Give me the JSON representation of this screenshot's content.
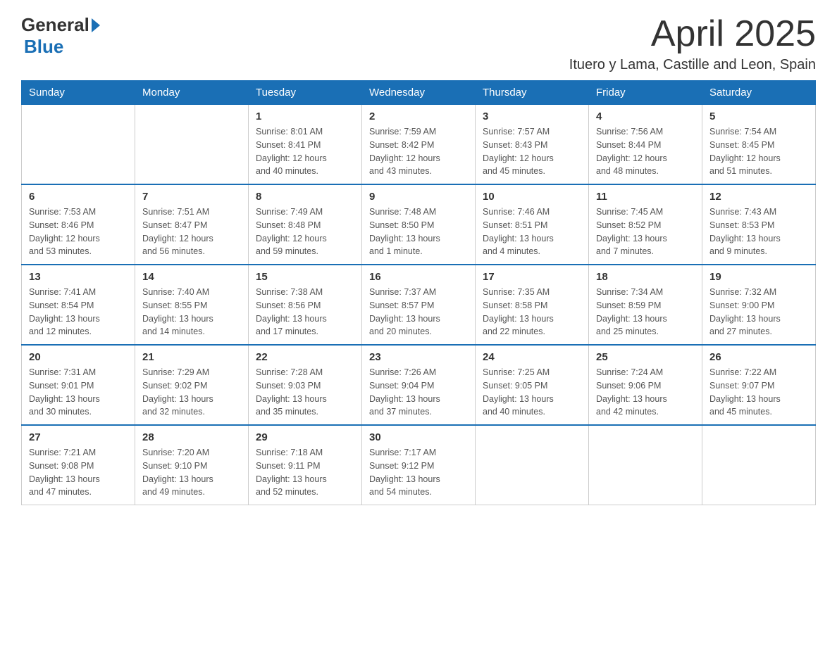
{
  "logo": {
    "general": "General",
    "blue": "Blue"
  },
  "title": "April 2025",
  "location": "Ituero y Lama, Castille and Leon, Spain",
  "days_of_week": [
    "Sunday",
    "Monday",
    "Tuesday",
    "Wednesday",
    "Thursday",
    "Friday",
    "Saturday"
  ],
  "weeks": [
    [
      {
        "day": "",
        "info": ""
      },
      {
        "day": "",
        "info": ""
      },
      {
        "day": "1",
        "info": "Sunrise: 8:01 AM\nSunset: 8:41 PM\nDaylight: 12 hours\nand 40 minutes."
      },
      {
        "day": "2",
        "info": "Sunrise: 7:59 AM\nSunset: 8:42 PM\nDaylight: 12 hours\nand 43 minutes."
      },
      {
        "day": "3",
        "info": "Sunrise: 7:57 AM\nSunset: 8:43 PM\nDaylight: 12 hours\nand 45 minutes."
      },
      {
        "day": "4",
        "info": "Sunrise: 7:56 AM\nSunset: 8:44 PM\nDaylight: 12 hours\nand 48 minutes."
      },
      {
        "day": "5",
        "info": "Sunrise: 7:54 AM\nSunset: 8:45 PM\nDaylight: 12 hours\nand 51 minutes."
      }
    ],
    [
      {
        "day": "6",
        "info": "Sunrise: 7:53 AM\nSunset: 8:46 PM\nDaylight: 12 hours\nand 53 minutes."
      },
      {
        "day": "7",
        "info": "Sunrise: 7:51 AM\nSunset: 8:47 PM\nDaylight: 12 hours\nand 56 minutes."
      },
      {
        "day": "8",
        "info": "Sunrise: 7:49 AM\nSunset: 8:48 PM\nDaylight: 12 hours\nand 59 minutes."
      },
      {
        "day": "9",
        "info": "Sunrise: 7:48 AM\nSunset: 8:50 PM\nDaylight: 13 hours\nand 1 minute."
      },
      {
        "day": "10",
        "info": "Sunrise: 7:46 AM\nSunset: 8:51 PM\nDaylight: 13 hours\nand 4 minutes."
      },
      {
        "day": "11",
        "info": "Sunrise: 7:45 AM\nSunset: 8:52 PM\nDaylight: 13 hours\nand 7 minutes."
      },
      {
        "day": "12",
        "info": "Sunrise: 7:43 AM\nSunset: 8:53 PM\nDaylight: 13 hours\nand 9 minutes."
      }
    ],
    [
      {
        "day": "13",
        "info": "Sunrise: 7:41 AM\nSunset: 8:54 PM\nDaylight: 13 hours\nand 12 minutes."
      },
      {
        "day": "14",
        "info": "Sunrise: 7:40 AM\nSunset: 8:55 PM\nDaylight: 13 hours\nand 14 minutes."
      },
      {
        "day": "15",
        "info": "Sunrise: 7:38 AM\nSunset: 8:56 PM\nDaylight: 13 hours\nand 17 minutes."
      },
      {
        "day": "16",
        "info": "Sunrise: 7:37 AM\nSunset: 8:57 PM\nDaylight: 13 hours\nand 20 minutes."
      },
      {
        "day": "17",
        "info": "Sunrise: 7:35 AM\nSunset: 8:58 PM\nDaylight: 13 hours\nand 22 minutes."
      },
      {
        "day": "18",
        "info": "Sunrise: 7:34 AM\nSunset: 8:59 PM\nDaylight: 13 hours\nand 25 minutes."
      },
      {
        "day": "19",
        "info": "Sunrise: 7:32 AM\nSunset: 9:00 PM\nDaylight: 13 hours\nand 27 minutes."
      }
    ],
    [
      {
        "day": "20",
        "info": "Sunrise: 7:31 AM\nSunset: 9:01 PM\nDaylight: 13 hours\nand 30 minutes."
      },
      {
        "day": "21",
        "info": "Sunrise: 7:29 AM\nSunset: 9:02 PM\nDaylight: 13 hours\nand 32 minutes."
      },
      {
        "day": "22",
        "info": "Sunrise: 7:28 AM\nSunset: 9:03 PM\nDaylight: 13 hours\nand 35 minutes."
      },
      {
        "day": "23",
        "info": "Sunrise: 7:26 AM\nSunset: 9:04 PM\nDaylight: 13 hours\nand 37 minutes."
      },
      {
        "day": "24",
        "info": "Sunrise: 7:25 AM\nSunset: 9:05 PM\nDaylight: 13 hours\nand 40 minutes."
      },
      {
        "day": "25",
        "info": "Sunrise: 7:24 AM\nSunset: 9:06 PM\nDaylight: 13 hours\nand 42 minutes."
      },
      {
        "day": "26",
        "info": "Sunrise: 7:22 AM\nSunset: 9:07 PM\nDaylight: 13 hours\nand 45 minutes."
      }
    ],
    [
      {
        "day": "27",
        "info": "Sunrise: 7:21 AM\nSunset: 9:08 PM\nDaylight: 13 hours\nand 47 minutes."
      },
      {
        "day": "28",
        "info": "Sunrise: 7:20 AM\nSunset: 9:10 PM\nDaylight: 13 hours\nand 49 minutes."
      },
      {
        "day": "29",
        "info": "Sunrise: 7:18 AM\nSunset: 9:11 PM\nDaylight: 13 hours\nand 52 minutes."
      },
      {
        "day": "30",
        "info": "Sunrise: 7:17 AM\nSunset: 9:12 PM\nDaylight: 13 hours\nand 54 minutes."
      },
      {
        "day": "",
        "info": ""
      },
      {
        "day": "",
        "info": ""
      },
      {
        "day": "",
        "info": ""
      }
    ]
  ]
}
